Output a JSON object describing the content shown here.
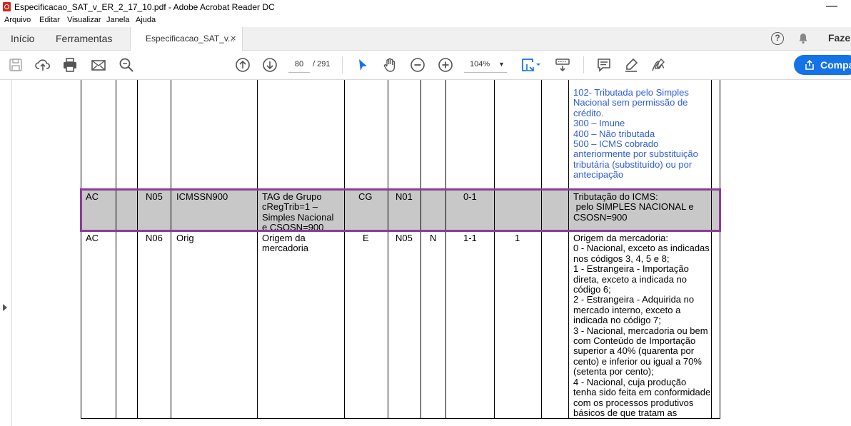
{
  "window": {
    "title": "Especificacao_SAT_v_ER_2_17_10.pdf - Adobe Acrobat Reader DC",
    "minimize_glyph": "—"
  },
  "menu": [
    "Arquivo",
    "Editar",
    "Visualizar",
    "Janela",
    "Ajuda"
  ],
  "tabs": {
    "home": "Início",
    "tools": "Ferramentas",
    "document": "Especificacao_SAT_v...",
    "close_glyph": "×"
  },
  "header_right": {
    "help_glyph": "?",
    "share_partial": "Faze"
  },
  "toolbar": {
    "icons": [
      "save-icon",
      "upload-icon",
      "print-icon",
      "email-icon",
      "search-icon",
      "previous-page-icon",
      "next-page-icon",
      "select-cursor-icon",
      "hand-tool-icon",
      "zoom-out-icon",
      "zoom-in-icon",
      "page-fit-icon",
      "scroll-mode-icon",
      "comment-icon",
      "highlight-pen-icon",
      "sign-icon",
      "share-icon"
    ],
    "page_current": "80",
    "page_total": "/ 291",
    "zoom": "104%",
    "share_label": "Compa"
  },
  "colors": {
    "accent": "#1473e6",
    "highlight_border": "#8b3d97",
    "row_gray": "#c8c8c8",
    "blue_text": "#2f5dd6"
  },
  "table": {
    "top_row": {
      "description": "102- Tributada pelo Simples\nNacional sem permissão de\ncrédito.\n300 – Imune\n400 – Não tributada\n500 – ICMS cobrado\nanteriormente por substituição\ntributária (substituído) ou por\nantecipação"
    },
    "highlighted_row": {
      "group": "AC",
      "id": "N05",
      "field": "ICMSSN900",
      "description_short": "TAG de Grupo\ncRegTrib=1 –\nSimples Nacional\ne CSOSN=900",
      "element": "CG",
      "parent": "N01",
      "type": "",
      "occurrence": "0-1",
      "size": "",
      "description": "Tributação do ICMS:\n pelo SIMPLES NACIONAL e\nCSOSN=900"
    },
    "next_row": {
      "group": "AC",
      "id": "N06",
      "field": "Orig",
      "description_short": "Origem da\nmercadoria",
      "element": "E",
      "parent": "N05",
      "type": "N",
      "occurrence": "1-1",
      "size": "1",
      "description": "Origem da mercadoria:\n0 - Nacional, exceto as indicadas\nnos códigos 3, 4, 5 e 8;\n1 - Estrangeira - Importação\ndireta, exceto a indicada no\ncódigo 6;\n2 - Estrangeira - Adquirida no\nmercado interno, exceto a\nindicada no código 7;\n3 - Nacional, mercadoria ou bem\ncom Conteúdo de Importação\nsuperior a 40% (quarenta por\ncento) e inferior ou igual a 70%\n(setenta por cento);\n4 - Nacional, cuja produção\ntenha sido feita em conformidade\ncom os processos produtivos\nbásicos de que tratam as"
    }
  }
}
